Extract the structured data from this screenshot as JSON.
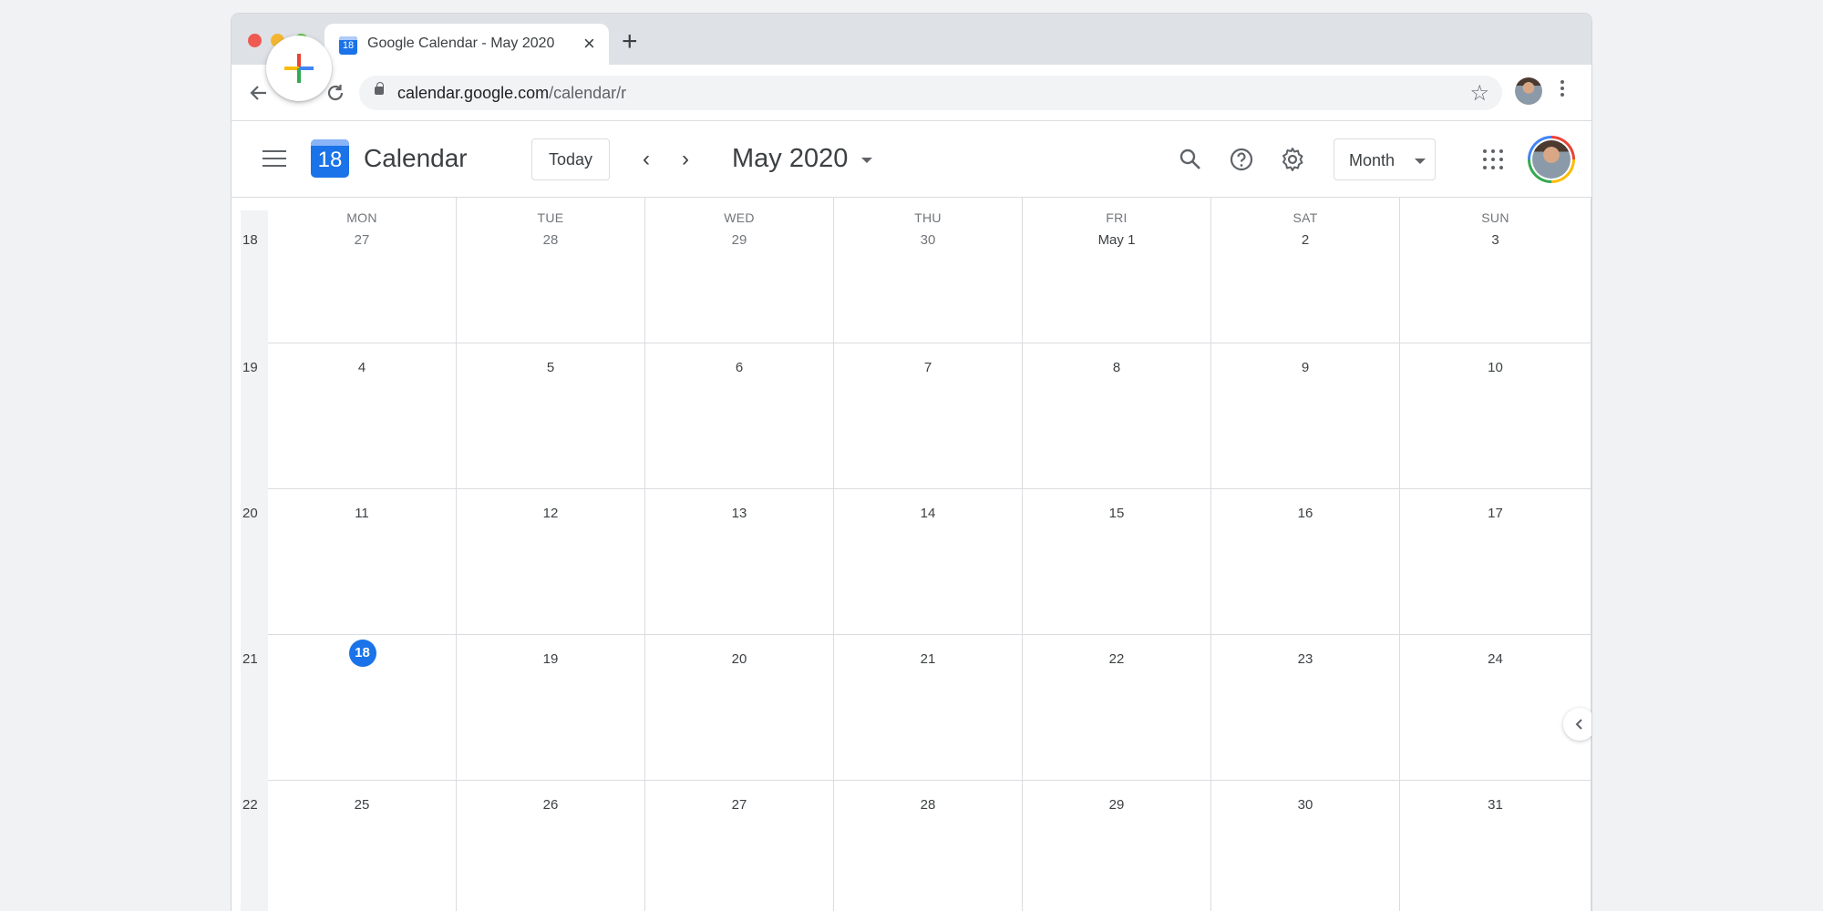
{
  "browser": {
    "tab_title": "Google Calendar - May 2020",
    "tab_favicon_text": "18",
    "url_domain": "calendar.google.com",
    "url_path": "/calendar/r"
  },
  "header": {
    "logo_day": "18",
    "app_name": "Calendar",
    "today_label": "Today",
    "month_title": "May 2020",
    "view_label": "Month"
  },
  "icons": [
    "menu-icon",
    "search-icon",
    "help-icon",
    "settings-icon",
    "apps-icon",
    "create-icon",
    "chevron-left-icon",
    "chevron-right-icon"
  ],
  "colors": {
    "accent": "#1a73e8",
    "today": "#1a73e8",
    "grid_line": "#dadce0",
    "text": "#3c4043"
  },
  "calendar": {
    "weekdays": [
      "MON",
      "TUE",
      "WED",
      "THU",
      "FRI",
      "SAT",
      "SUN"
    ],
    "weeks": [
      {
        "num": "18",
        "days": [
          "27",
          "28",
          "29",
          "30",
          "May 1",
          "2",
          "3"
        ]
      },
      {
        "num": "19",
        "days": [
          "4",
          "5",
          "6",
          "7",
          "8",
          "9",
          "10"
        ]
      },
      {
        "num": "20",
        "days": [
          "11",
          "12",
          "13",
          "14",
          "15",
          "16",
          "17"
        ]
      },
      {
        "num": "21",
        "days": [
          "18",
          "19",
          "20",
          "21",
          "22",
          "23",
          "24"
        ]
      },
      {
        "num": "22",
        "days": [
          "25",
          "26",
          "27",
          "28",
          "29",
          "30",
          "31"
        ]
      }
    ],
    "today": "18"
  }
}
